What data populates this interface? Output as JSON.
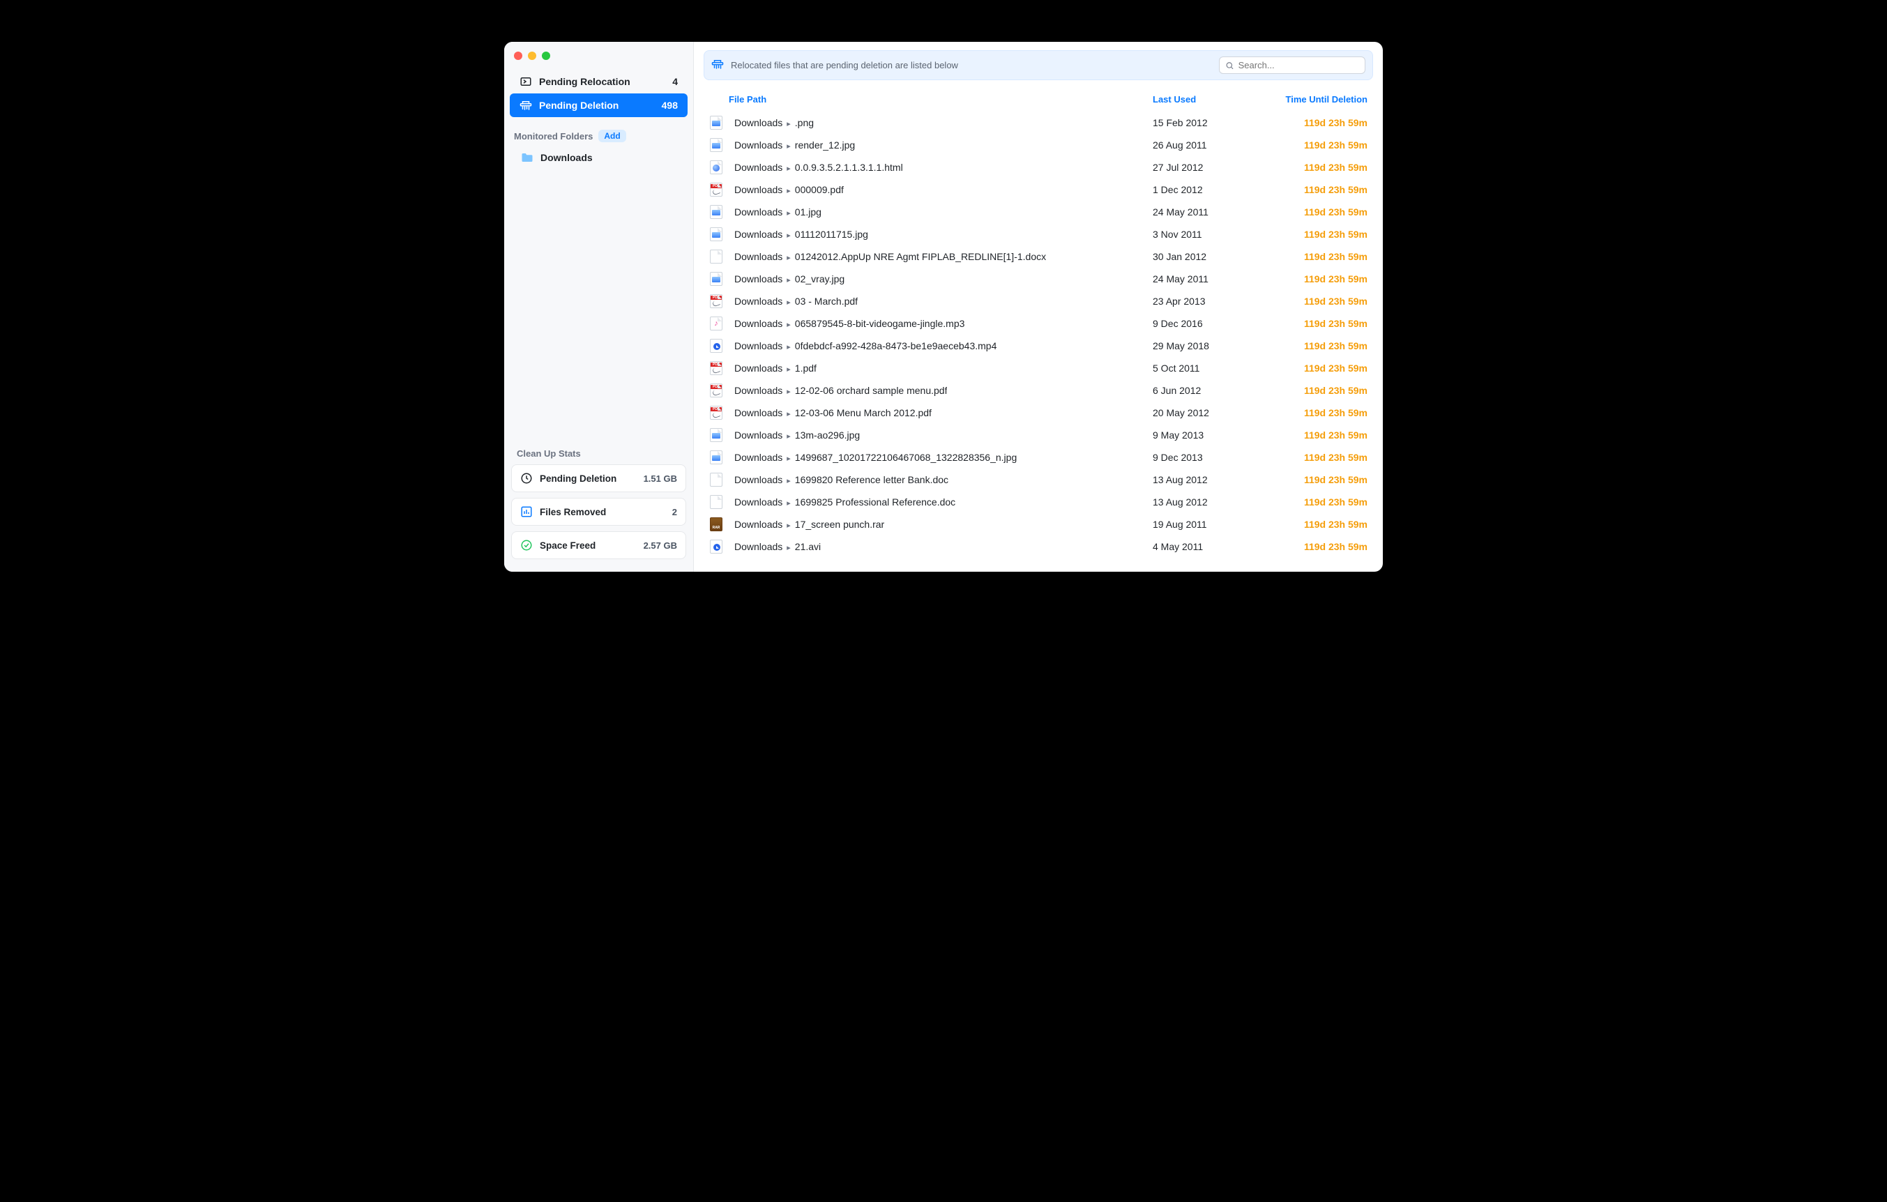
{
  "sidebar": {
    "nav": [
      {
        "label": "Pending Relocation",
        "count": "4"
      },
      {
        "label": "Pending Deletion",
        "count": "498"
      }
    ],
    "monitored_heading": "Monitored Folders",
    "add_label": "Add",
    "folders": [
      {
        "label": "Downloads"
      }
    ],
    "stats_heading": "Clean Up Stats",
    "stats": [
      {
        "label": "Pending Deletion",
        "value": "1.51 GB"
      },
      {
        "label": "Files Removed",
        "value": "2"
      },
      {
        "label": "Space Freed",
        "value": "2.57 GB"
      }
    ]
  },
  "banner": {
    "message": "Relocated files that are pending deletion are listed below",
    "search_placeholder": "Search..."
  },
  "table": {
    "headers": {
      "path": "File Path",
      "last_used": "Last Used",
      "time_until": "Time Until Deletion"
    },
    "path_dir": "Downloads",
    "path_sep": "▸",
    "rows": [
      {
        "icon": "img",
        "name": ".png",
        "last_used": "15 Feb 2012",
        "time_until": "119d 23h 59m"
      },
      {
        "icon": "img",
        "name": "render_12.jpg",
        "last_used": "26 Aug 2011",
        "time_until": "119d 23h 59m"
      },
      {
        "icon": "html",
        "name": "0.0.9.3.5.2.1.1.3.1.1.html",
        "last_used": "27 Jul 2012",
        "time_until": "119d 23h 59m"
      },
      {
        "icon": "pdf",
        "name": "000009.pdf",
        "last_used": "1 Dec 2012",
        "time_until": "119d 23h 59m"
      },
      {
        "icon": "img",
        "name": "01.jpg",
        "last_used": "24 May 2011",
        "time_until": "119d 23h 59m"
      },
      {
        "icon": "img",
        "name": "01112011715.jpg",
        "last_used": "3 Nov 2011",
        "time_until": "119d 23h 59m"
      },
      {
        "icon": "doc",
        "name": "01242012.AppUp NRE Agmt FIPLAB_REDLINE[1]-1.docx",
        "last_used": "30 Jan 2012",
        "time_until": "119d 23h 59m"
      },
      {
        "icon": "img",
        "name": "02_vray.jpg",
        "last_used": "24 May 2011",
        "time_until": "119d 23h 59m"
      },
      {
        "icon": "pdf",
        "name": "03 - March.pdf",
        "last_used": "23 Apr 2013",
        "time_until": "119d 23h 59m"
      },
      {
        "icon": "mp3",
        "name": "065879545-8-bit-videogame-jingle.mp3",
        "last_used": "9 Dec 2016",
        "time_until": "119d 23h 59m"
      },
      {
        "icon": "mp4",
        "name": "0fdebdcf-a992-428a-8473-be1e9aeceb43.mp4",
        "last_used": "29 May 2018",
        "time_until": "119d 23h 59m"
      },
      {
        "icon": "pdf",
        "name": "1.pdf",
        "last_used": "5 Oct 2011",
        "time_until": "119d 23h 59m"
      },
      {
        "icon": "pdf",
        "name": "12-02-06 orchard sample menu.pdf",
        "last_used": "6 Jun 2012",
        "time_until": "119d 23h 59m"
      },
      {
        "icon": "pdf",
        "name": "12-03-06 Menu March 2012.pdf",
        "last_used": "20 May 2012",
        "time_until": "119d 23h 59m"
      },
      {
        "icon": "img",
        "name": "13m-ao296.jpg",
        "last_used": "9 May 2013",
        "time_until": "119d 23h 59m"
      },
      {
        "icon": "img",
        "name": "1499687_10201722106467068_1322828356_n.jpg",
        "last_used": "9 Dec 2013",
        "time_until": "119d 23h 59m"
      },
      {
        "icon": "doc",
        "name": "1699820 Reference letter Bank.doc",
        "last_used": "13 Aug 2012",
        "time_until": "119d 23h 59m"
      },
      {
        "icon": "doc",
        "name": "1699825 Professional Reference.doc",
        "last_used": "13 Aug 2012",
        "time_until": "119d 23h 59m"
      },
      {
        "icon": "rar",
        "name": "17_screen punch.rar",
        "last_used": "19 Aug 2011",
        "time_until": "119d 23h 59m"
      },
      {
        "icon": "mp4",
        "name": "21.avi",
        "last_used": "4 May 2011",
        "time_until": "119d 23h 59m"
      }
    ]
  }
}
